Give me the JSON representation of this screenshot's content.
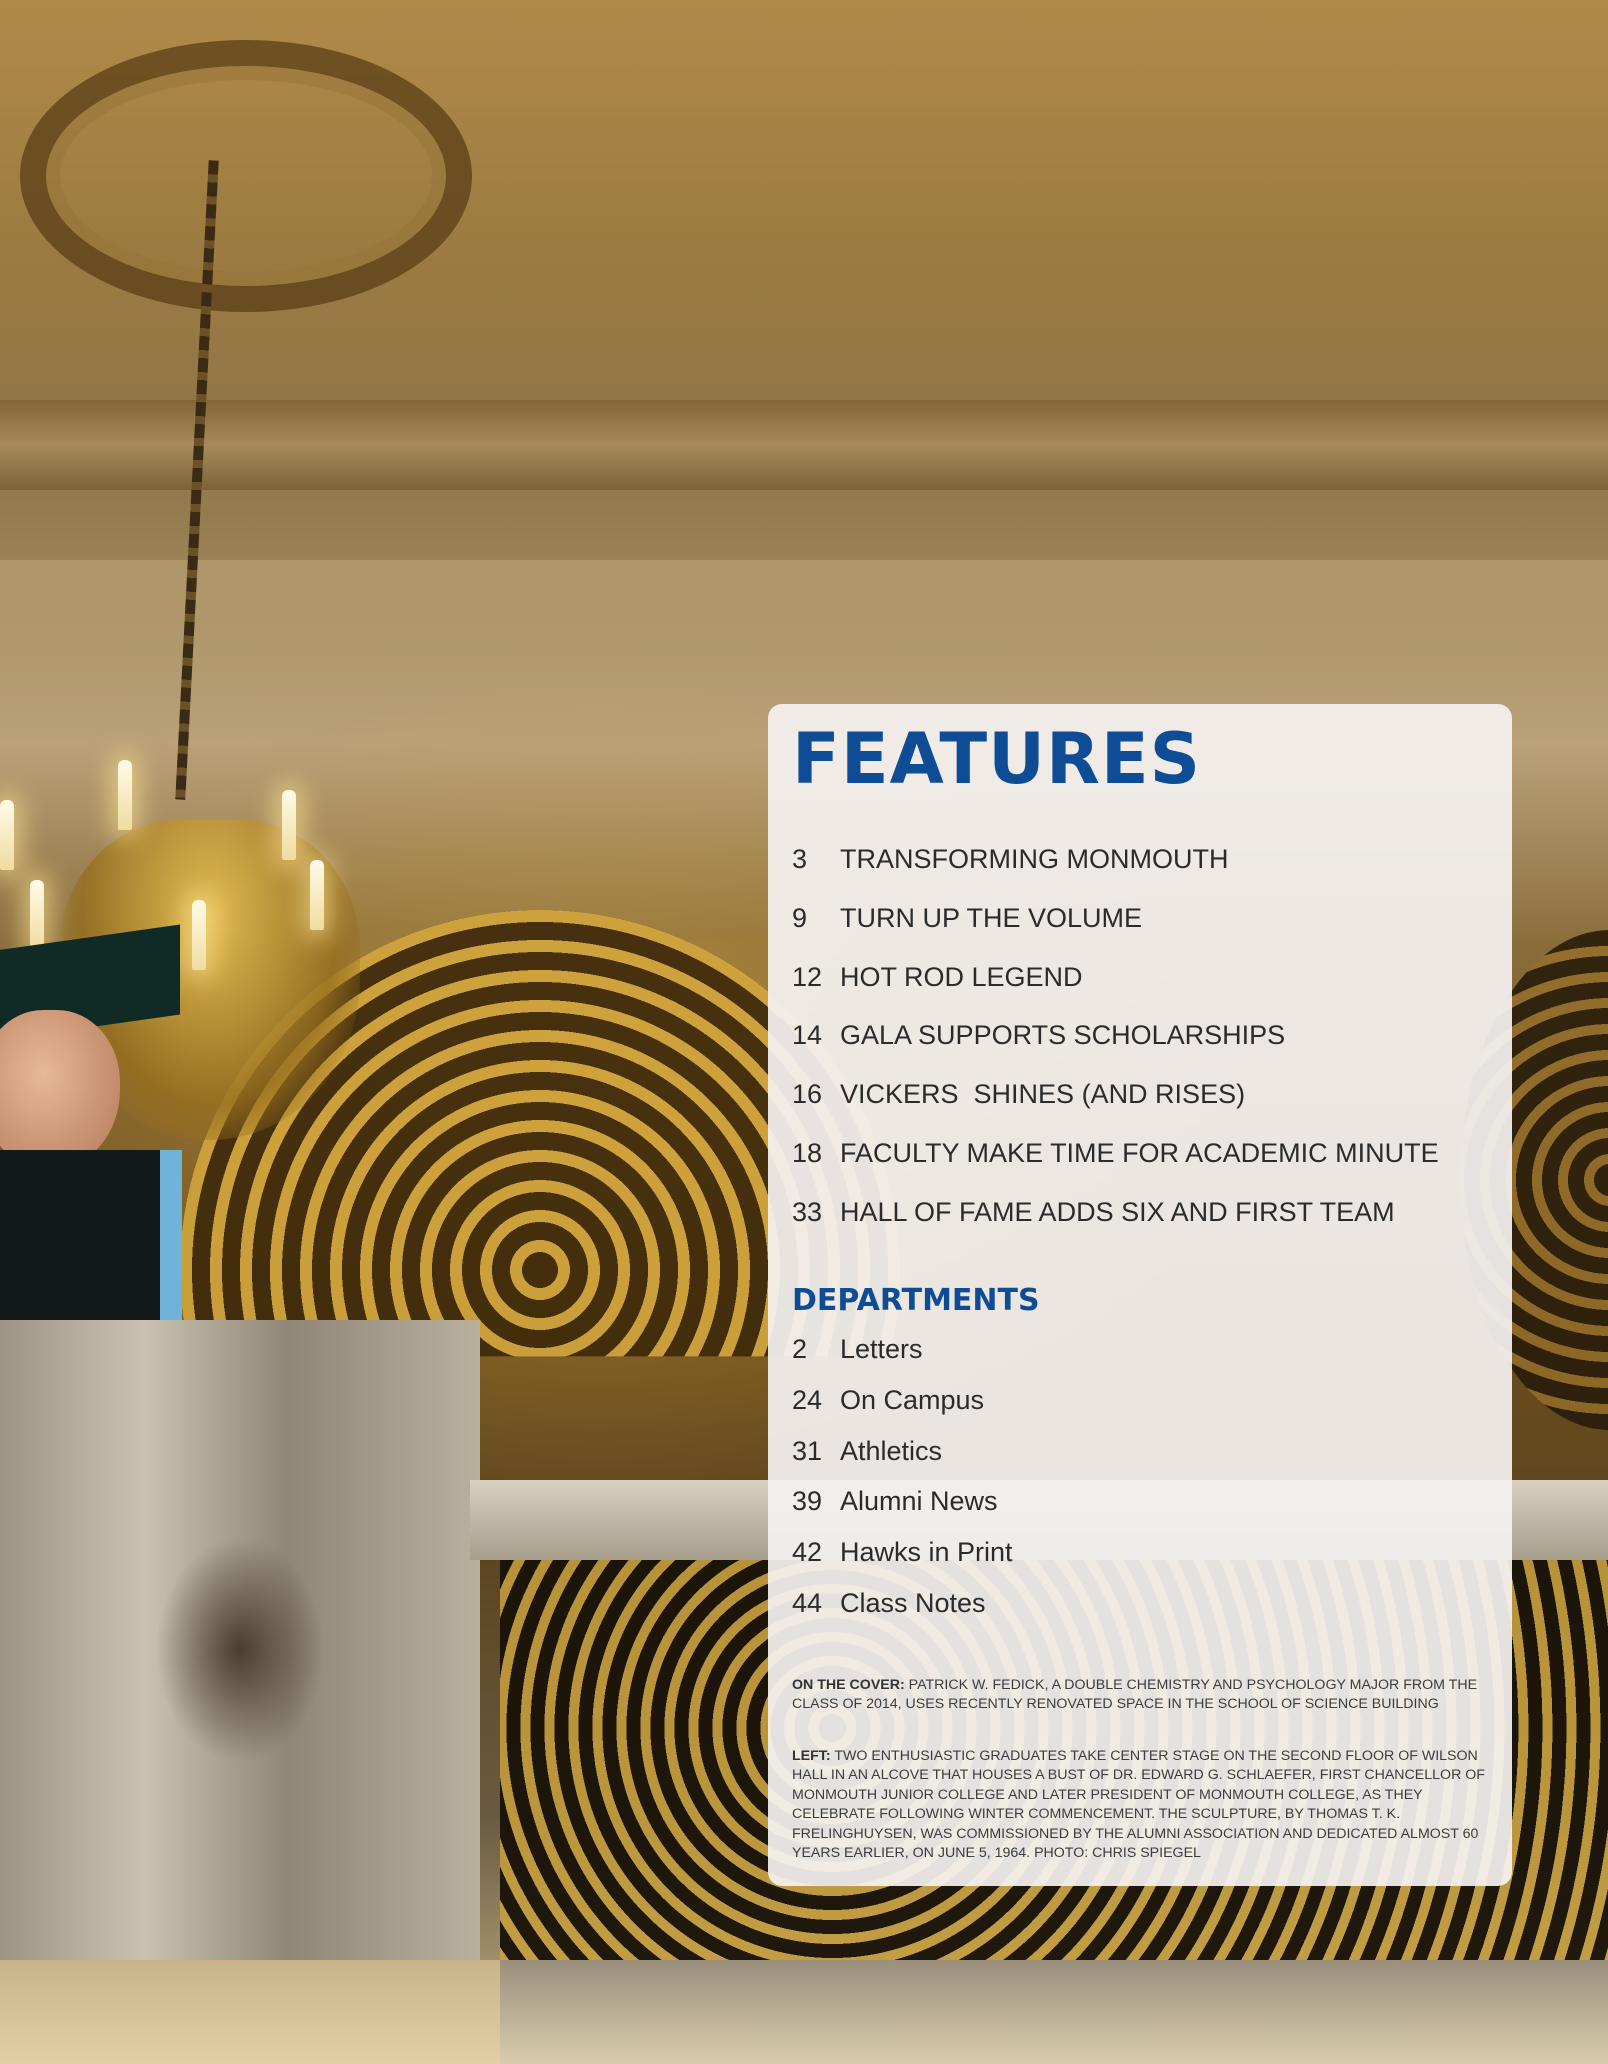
{
  "features": {
    "heading": "FEATURES",
    "items": [
      {
        "page": "3",
        "title": "TRANSFORMING MONMOUTH"
      },
      {
        "page": "9",
        "title": "TURN UP THE VOLUME"
      },
      {
        "page": "12",
        "title": "HOT ROD LEGEND"
      },
      {
        "page": "14",
        "title": "GALA SUPPORTS SCHOLARSHIPS"
      },
      {
        "page": "16",
        "title": "VICKERS  SHINES (AND RISES)"
      },
      {
        "page": "18",
        "title": "FACULTY MAKE TIME FOR ACADEMIC MINUTE"
      },
      {
        "page": "33",
        "title": "HALL OF FAME ADDS SIX AND FIRST TEAM"
      }
    ]
  },
  "departments": {
    "heading": "DEPARTMENTS",
    "items": [
      {
        "page": "2",
        "title": "Letters"
      },
      {
        "page": "24",
        "title": "On Campus"
      },
      {
        "page": "31",
        "title": "Athletics"
      },
      {
        "page": "39",
        "title": "Alumni News"
      },
      {
        "page": "42",
        "title": "Hawks in Print"
      },
      {
        "page": "44",
        "title": "Class Notes"
      }
    ]
  },
  "captions": {
    "cover_label": "ON THE COVER:",
    "cover_text": "PATRICK W. FEDICK, A DOUBLE CHEMISTRY AND PSYCHOLOGY MAJOR FROM THE CLASS OF 2014, USES RECENTLY RENOVATED SPACE IN THE SCHOOL OF SCIENCE BUILDING",
    "left_label": "LEFT:",
    "left_text": "TWO ENTHUSIASTIC GRADUATES TAKE CENTER STAGE ON THE SECOND FLOOR OF WILSON HALL IN AN ALCOVE THAT HOUSES A BUST OF DR. EDWARD G. SCHLAEFER, FIRST CHANCELLOR OF MONMOUTH JUNIOR COLLEGE AND LATER PRESIDENT OF MONMOUTH COLLEGE, AS THEY CELEBRATE FOLLOWING WINTER COMMENCEMENT.  THE SCULPTURE, BY THOMAS T. K. FRELINGHUYSEN, WAS COMMISSIONED BY THE ALUMNI ASSOCIATION AND DEDICATED ALMOST 60 YEARS EARLIER, ON JUNE 5, 1964. PHOTO: CHRIS SPIEGEL"
  },
  "colors": {
    "heading_blue": "#0e4d95",
    "panel_background": "#f4f1f0",
    "body_text": "#2b2b2b"
  }
}
